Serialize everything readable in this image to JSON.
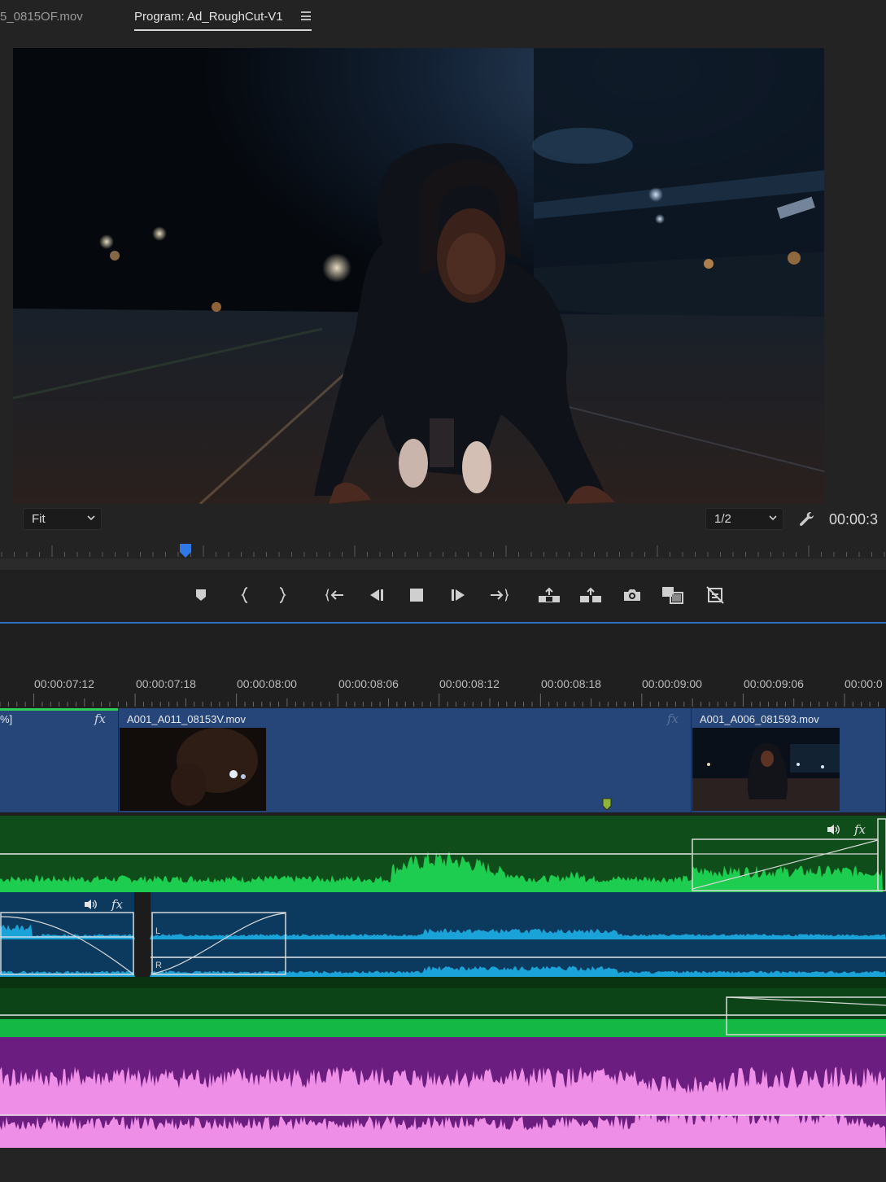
{
  "monitor": {
    "source_tab_label": "5_0815OF.mov",
    "program_tab_label": "Program: Ad_RoughCut-V1",
    "zoom_value": "Fit",
    "resolution_value": "1/2",
    "timecode": "00:00:3"
  },
  "transport_buttons": [
    "add-marker",
    "mark-in",
    "mark-out",
    "go-to-in",
    "step-back",
    "stop",
    "step-forward",
    "go-to-out",
    "lift",
    "extract",
    "export-frame",
    "insert-overlay",
    "toggle-proxies"
  ],
  "timeline": {
    "ruler_labels": [
      "00:00:07:12",
      "00:00:07:18",
      "00:00:08:00",
      "00:00:08:06",
      "00:00:08:12",
      "00:00:08:18",
      "00:00:09:00",
      "00:00:09:06",
      "00:00:0"
    ],
    "video_clips": [
      {
        "name": "%]",
        "fx": "fx"
      },
      {
        "name": "A001_A011_08153V.mov",
        "fx": "fx"
      },
      {
        "name": "A001_A006_081593.mov"
      }
    ],
    "a1_icons": {
      "fx": "fx"
    },
    "a2_icons": {
      "fx": "fx"
    },
    "a2_channel_left": "L",
    "a2_channel_right": "R"
  },
  "colors": {
    "video_clip": "#26467a",
    "audio_green": "#15c44c",
    "audio_blue": "#1aa3d9",
    "audio_pink": "#f08ee6",
    "playhead": "#2f78e6",
    "selection_line": "#2f6fc4"
  }
}
